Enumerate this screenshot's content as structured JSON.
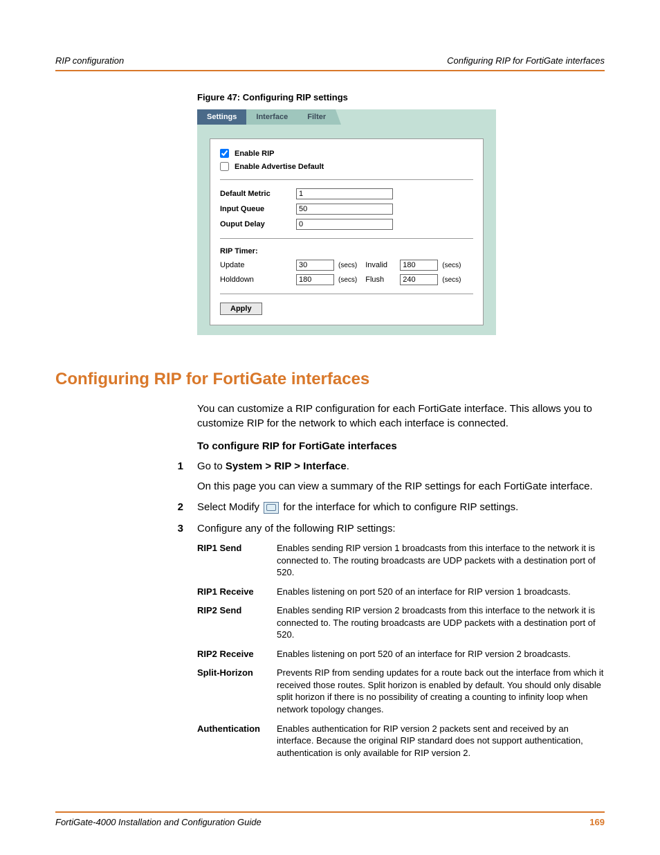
{
  "header": {
    "left": "RIP configuration",
    "right": "Configuring RIP for FortiGate interfaces"
  },
  "figure_caption": "Figure 47: Configuring RIP settings",
  "tabs": {
    "settings": "Settings",
    "interface": "Interface",
    "filter": "Filter"
  },
  "panel": {
    "enable_rip_label": "Enable RIP",
    "enable_rip_checked": true,
    "enable_adv_default_label": "Enable Advertise Default",
    "enable_adv_default_checked": false,
    "default_metric_label": "Default Metric",
    "default_metric_value": "1",
    "input_queue_label": "Input Queue",
    "input_queue_value": "50",
    "output_delay_label": "Ouput Delay",
    "output_delay_value": "0",
    "rip_timer_label": "RIP Timer:",
    "update_label": "Update",
    "update_value": "30",
    "invalid_label": "Invalid",
    "invalid_value": "180",
    "holddown_label": "Holddown",
    "holddown_value": "180",
    "flush_label": "Flush",
    "flush_value": "240",
    "secs": "(secs)",
    "apply_label": "Apply"
  },
  "section_heading": "Configuring RIP for FortiGate interfaces",
  "intro": "You can customize a RIP configuration for each FortiGate interface. This allows you to customize RIP for the network to which each interface is connected.",
  "subhead": "To configure RIP for FortiGate interfaces",
  "steps": {
    "s1_num": "1",
    "s1_a": "Go to ",
    "s1_b": "System > RIP > Interface",
    "s1_c": ".",
    "s1_d": "On this page you can view a summary of the RIP settings for each FortiGate interface.",
    "s2_num": "2",
    "s2_a": "Select Modify ",
    "s2_b": " for the interface for which to configure RIP settings.",
    "s3_num": "3",
    "s3_a": "Configure any of the following RIP settings:"
  },
  "defs": [
    {
      "term": "RIP1 Send",
      "desc": "Enables sending RIP version 1 broadcasts from this interface to the network it is connected to. The routing broadcasts are UDP packets with a destination port of 520."
    },
    {
      "term": "RIP1 Receive",
      "desc": "Enables listening on port 520 of an interface for RIP version 1 broadcasts."
    },
    {
      "term": "RIP2 Send",
      "desc": "Enables sending RIP version 2 broadcasts from this interface to the network it is connected to. The routing broadcasts are UDP packets with a destination port of 520."
    },
    {
      "term": "RIP2 Receive",
      "desc": "Enables listening on port 520 of an interface for RIP version 2 broadcasts."
    },
    {
      "term": "Split-Horizon",
      "desc": "Prevents RIP from sending updates for a route back out the interface from which it received those routes. Split horizon is enabled by default. You should only disable split horizon if there is no possibility of creating a counting to infinity loop when network topology changes."
    },
    {
      "term": "Authentication",
      "desc": "Enables authentication for RIP version 2 packets sent and received by an interface. Because the original RIP standard does not support authentication, authentication is only available for RIP version 2."
    }
  ],
  "footer": {
    "left": "FortiGate-4000 Installation and Configuration Guide",
    "right": "169"
  }
}
